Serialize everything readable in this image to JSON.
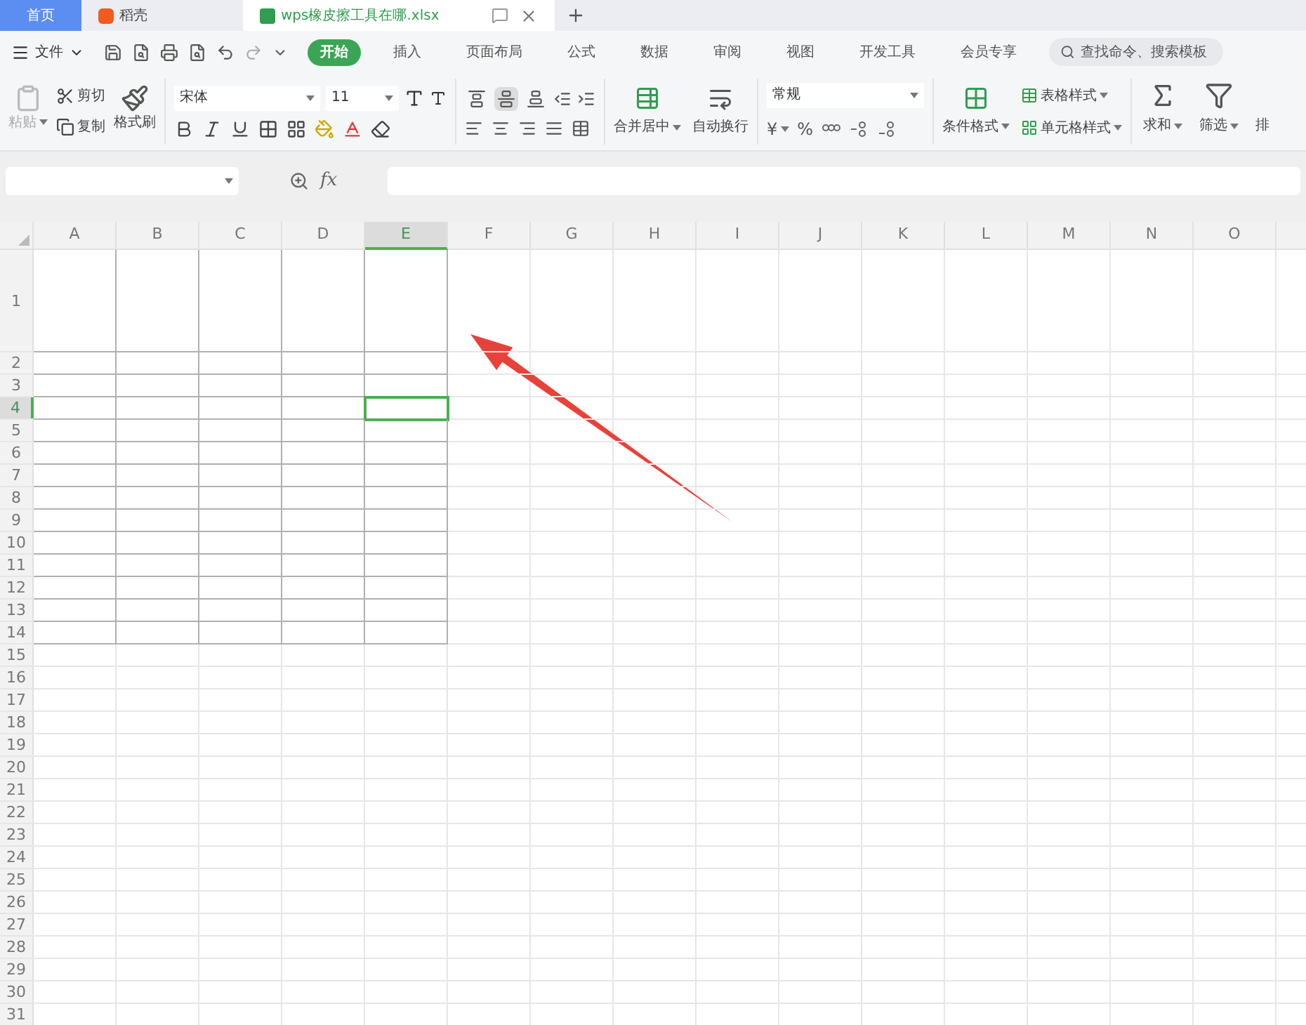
{
  "tabs": [
    {
      "kind": "home",
      "label": "首页",
      "selected": false
    },
    {
      "kind": "docer",
      "label": "稻壳",
      "selected": false
    },
    {
      "kind": "file",
      "label": "wps橡皮擦工具在哪.xlsx",
      "selected": true
    }
  ],
  "menu": {
    "file_label": "文件",
    "items": [
      {
        "label": "开始",
        "selected": true
      },
      {
        "label": "插入",
        "selected": false
      },
      {
        "label": "页面布局",
        "selected": false
      },
      {
        "label": "公式",
        "selected": false
      },
      {
        "label": "数据",
        "selected": false
      },
      {
        "label": "审阅",
        "selected": false
      },
      {
        "label": "视图",
        "selected": false
      },
      {
        "label": "开发工具",
        "selected": false
      },
      {
        "label": "会员专享",
        "selected": false
      }
    ],
    "search_placeholder": "查找命令、搜索模板"
  },
  "ribbon": {
    "clipboard": {
      "paste": {
        "label": "粘贴",
        "disabled": true
      },
      "cut": "剪切",
      "copy": "复制",
      "format_painter": "格式刷"
    },
    "font": {
      "font_name": "宋体",
      "font_size": "11"
    },
    "alignment": {
      "vertical": [
        {
          "kind": "top",
          "selected": false
        },
        {
          "kind": "middle",
          "selected": true
        },
        {
          "kind": "bottom",
          "selected": false
        }
      ],
      "merge_center": "合并居中",
      "wrap_text": "自动换行"
    },
    "number": {
      "format": "常规",
      "currency": "¥",
      "percent": "%"
    },
    "styles": {
      "conditional_format": "条件格式",
      "table_style": "表格样式",
      "cell_style": "单元格样式"
    },
    "editing": {
      "sum": "求和",
      "filter": "筛选",
      "cut_off": "排"
    }
  },
  "formula_bar": {
    "function_label": "fx"
  },
  "sheet": {
    "columns": [
      {
        "label": "A",
        "selected": false,
        "bordered": true
      },
      {
        "label": "B",
        "selected": false,
        "bordered": true
      },
      {
        "label": "C",
        "selected": false,
        "bordered": true
      },
      {
        "label": "D",
        "selected": false,
        "bordered": true
      },
      {
        "label": "E",
        "selected": true,
        "bordered": true
      },
      {
        "label": "F",
        "selected": false,
        "bordered": false
      },
      {
        "label": "G",
        "selected": false,
        "bordered": false
      },
      {
        "label": "H",
        "selected": false,
        "bordered": false
      },
      {
        "label": "I",
        "selected": false,
        "bordered": false
      },
      {
        "label": "J",
        "selected": false,
        "bordered": false
      },
      {
        "label": "K",
        "selected": false,
        "bordered": false
      },
      {
        "label": "L",
        "selected": false,
        "bordered": false
      },
      {
        "label": "M",
        "selected": false,
        "bordered": false
      },
      {
        "label": "N",
        "selected": false,
        "bordered": false
      },
      {
        "label": "O",
        "selected": false,
        "bordered": false
      }
    ],
    "rows": [
      {
        "label": "1",
        "selected": false,
        "bordered": true,
        "tall": true
      },
      {
        "label": "2",
        "selected": false,
        "bordered": true,
        "tall": false
      },
      {
        "label": "3",
        "selected": false,
        "bordered": true,
        "tall": false
      },
      {
        "label": "4",
        "selected": true,
        "bordered": true,
        "tall": false
      },
      {
        "label": "5",
        "selected": false,
        "bordered": true,
        "tall": false
      },
      {
        "label": "6",
        "selected": false,
        "bordered": true,
        "tall": false
      },
      {
        "label": "7",
        "selected": false,
        "bordered": true,
        "tall": false
      },
      {
        "label": "8",
        "selected": false,
        "bordered": true,
        "tall": false
      },
      {
        "label": "9",
        "selected": false,
        "bordered": true,
        "tall": false
      },
      {
        "label": "10",
        "selected": false,
        "bordered": true,
        "tall": false
      },
      {
        "label": "11",
        "selected": false,
        "bordered": true,
        "tall": false
      },
      {
        "label": "12",
        "selected": false,
        "bordered": true,
        "tall": false
      },
      {
        "label": "13",
        "selected": false,
        "bordered": true,
        "tall": false
      },
      {
        "label": "14",
        "selected": false,
        "bordered": true,
        "tall": false
      },
      {
        "label": "15",
        "selected": false,
        "bordered": false,
        "tall": false
      },
      {
        "label": "16",
        "selected": false,
        "bordered": false,
        "tall": false
      },
      {
        "label": "17",
        "selected": false,
        "bordered": false,
        "tall": false
      },
      {
        "label": "18",
        "selected": false,
        "bordered": false,
        "tall": false
      },
      {
        "label": "19",
        "selected": false,
        "bordered": false,
        "tall": false
      },
      {
        "label": "20",
        "selected": false,
        "bordered": false,
        "tall": false
      },
      {
        "label": "21",
        "selected": false,
        "bordered": false,
        "tall": false
      },
      {
        "label": "22",
        "selected": false,
        "bordered": false,
        "tall": false
      },
      {
        "label": "23",
        "selected": false,
        "bordered": false,
        "tall": false
      },
      {
        "label": "24",
        "selected": false,
        "bordered": false,
        "tall": false
      },
      {
        "label": "25",
        "selected": false,
        "bordered": false,
        "tall": false
      },
      {
        "label": "26",
        "selected": false,
        "bordered": false,
        "tall": false
      },
      {
        "label": "27",
        "selected": false,
        "bordered": false,
        "tall": false
      },
      {
        "label": "28",
        "selected": false,
        "bordered": false,
        "tall": false
      },
      {
        "label": "29",
        "selected": false,
        "bordered": false,
        "tall": false
      },
      {
        "label": "30",
        "selected": false,
        "bordered": false,
        "tall": false
      },
      {
        "label": "31",
        "selected": false,
        "bordered": false,
        "tall": false
      }
    ]
  }
}
